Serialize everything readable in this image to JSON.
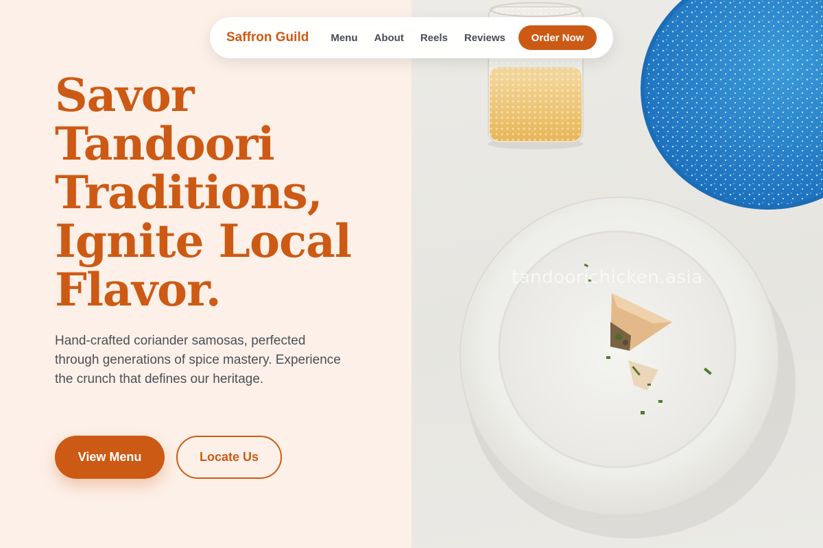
{
  "nav": {
    "brand": "Saffron Guild",
    "links": [
      "Menu",
      "About",
      "Reels",
      "Reviews"
    ],
    "cta": "Order Now"
  },
  "hero": {
    "title_lines": [
      "Savor",
      "Tandoori",
      "Traditions,",
      "Ignite Local",
      "Flavor."
    ],
    "subtitle": "Hand-crafted coriander samosas, perfected through generations of spice mastery. Experience the crunch that defines our heritage.",
    "primary_button": "View Menu",
    "secondary_button": "Locate Us"
  },
  "image": {
    "watermark": "tandoorichicken.asia"
  },
  "colors": {
    "accent": "#cc5a14",
    "background": "#fdf0e8",
    "body_text": "#4a4f57"
  }
}
